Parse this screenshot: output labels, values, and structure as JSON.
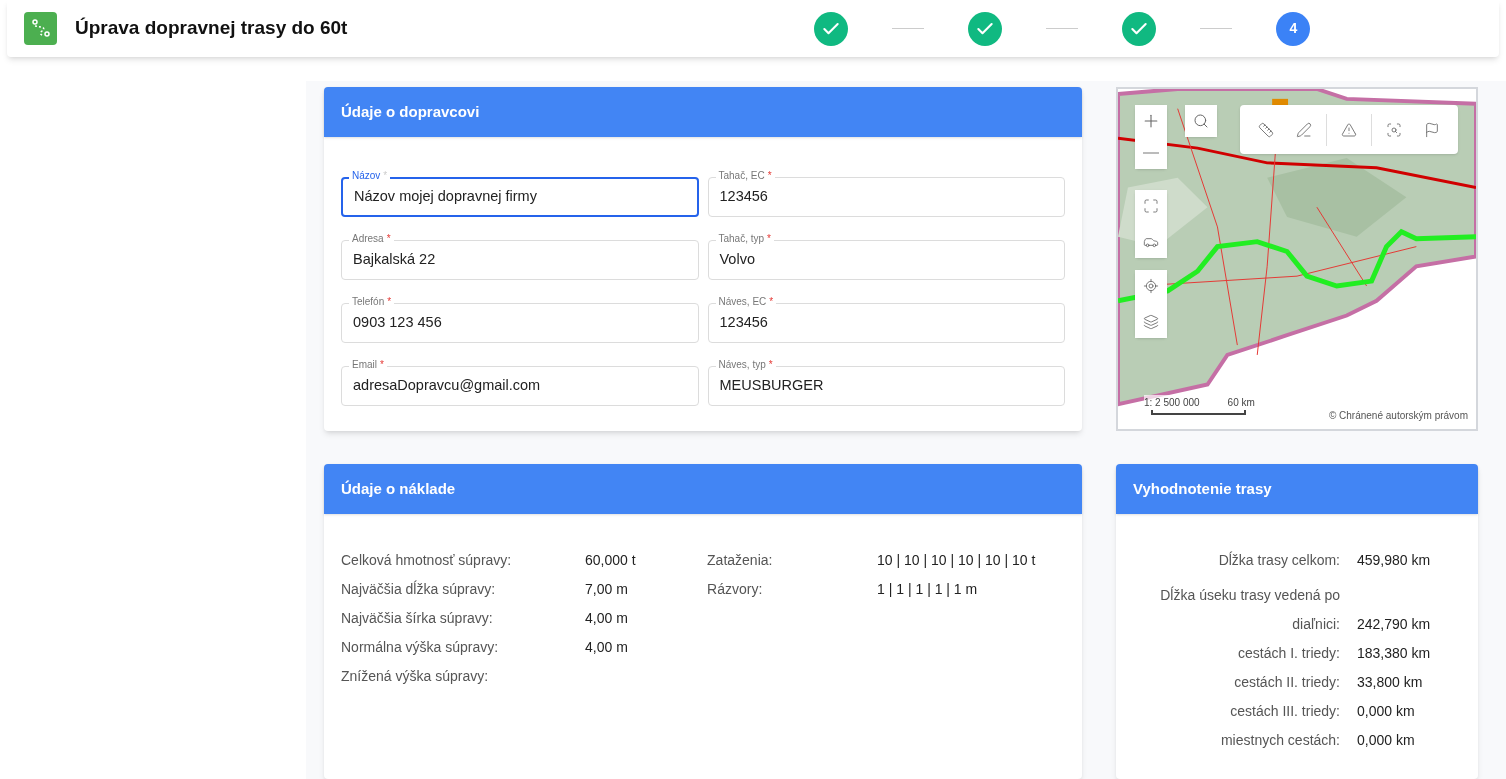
{
  "header": {
    "title": "Úprava dopravnej trasy do 60t"
  },
  "steps": [
    {
      "kind": "done"
    },
    {
      "kind": "done"
    },
    {
      "kind": "done"
    },
    {
      "kind": "current",
      "label": "4"
    }
  ],
  "carrier_card": {
    "title": "Údaje o dopravcovi",
    "fields": [
      {
        "label": "Názov",
        "value": "Názov mojej dopravnej firmy",
        "required_mark": "*",
        "focused": true
      },
      {
        "label": "Tahač, EC",
        "value": "123456",
        "required_mark": "*",
        "focused": false
      },
      {
        "label": "Adresa",
        "value": "Bajkalská 22",
        "required_mark": "*",
        "focused": false
      },
      {
        "label": "Tahač, typ",
        "value": "Volvo",
        "required_mark": "*",
        "focused": false
      },
      {
        "label": "Telefón",
        "value": "0903 123 456",
        "required_mark": "*",
        "focused": false
      },
      {
        "label": "Náves, EC",
        "value": "123456",
        "required_mark": "*",
        "focused": false
      },
      {
        "label": "Email",
        "value": "adresaDopravcu@gmail.com",
        "required_mark": "*",
        "focused": false
      },
      {
        "label": "Náves, typ",
        "value": "MEUSBURGER",
        "required_mark": "*",
        "focused": false
      }
    ]
  },
  "map": {
    "scale": "1: 2 500 000",
    "distance": "60 km",
    "copyright": "© Chránené autorským právom"
  },
  "load_card": {
    "title": "Údaje o náklade",
    "columns": [
      [
        {
          "label": "Celková hmotnosť súpravy:",
          "value": "60,000 t"
        },
        {
          "label": "Najväčšia dĺžka súpravy:",
          "value": "7,00 m"
        },
        {
          "label": "Najväčšia šírka súpravy:",
          "value": "4,00 m"
        },
        {
          "label": "Normálna výška súpravy:",
          "value": "4,00 m"
        },
        {
          "label": "Znížená výška súpravy:"
        }
      ],
      [
        {
          "label": "Zataženia:",
          "value": "10 | 10 | 10 | 10 | 10 | 10 t"
        },
        {
          "label": "Rázvory:",
          "value": "1 | 1 | 1 | 1 | 1 m"
        }
      ]
    ]
  },
  "route_card": {
    "title": "Vyhodnotenie trasy",
    "rows": [
      {
        "kind": "row",
        "label": "Dĺžka trasy celkom:",
        "value": "459,980 km"
      },
      {
        "kind": "heading",
        "label": "Dĺžka úseku trasy vedená po"
      },
      {
        "kind": "row",
        "label": "diaľnici:",
        "value": "242,790 km"
      },
      {
        "kind": "row",
        "label": "cestách I. triedy:",
        "value": "183,380 km"
      },
      {
        "kind": "row",
        "label": "cestách II. triedy:",
        "value": "33,800 km"
      },
      {
        "kind": "row",
        "label": "cestách III. triedy:",
        "value": "0,000 km"
      },
      {
        "kind": "row",
        "label": "miestnych cestách:",
        "value": "0,000 km"
      }
    ]
  }
}
